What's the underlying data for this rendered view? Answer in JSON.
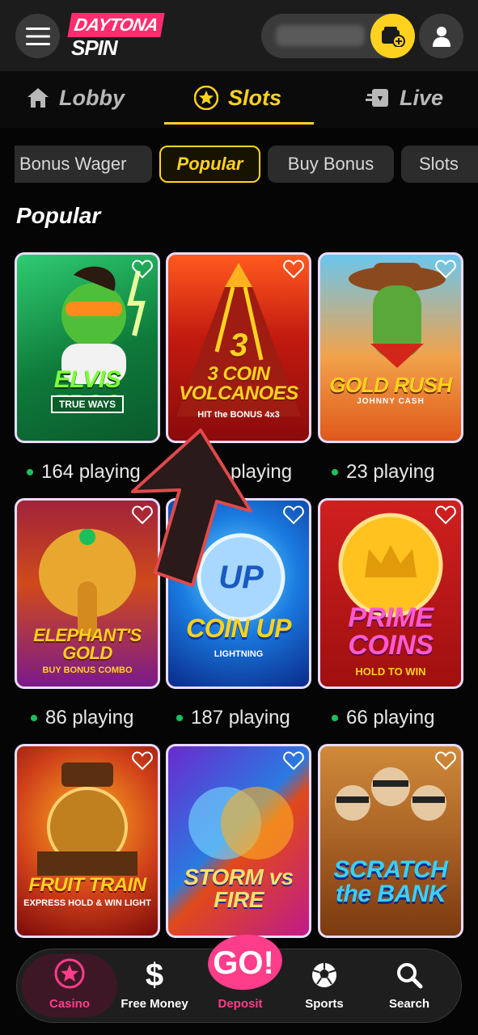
{
  "header": {
    "logo_top": "DAYTONA",
    "logo_bottom": "SPIN",
    "icons": {
      "menu": "menu-icon",
      "wallet": "wallet-add-icon",
      "profile": "user-icon"
    }
  },
  "main_tabs": [
    {
      "label": "Lobby",
      "icon": "home-icon",
      "active": false
    },
    {
      "label": "Slots",
      "icon": "star-icon",
      "active": true
    },
    {
      "label": "Live",
      "icon": "live-cards-icon",
      "active": false
    }
  ],
  "chips": [
    {
      "label": "Bonus Wager",
      "active": false
    },
    {
      "label": "Popular",
      "active": true
    },
    {
      "label": "Buy Bonus",
      "active": false
    },
    {
      "label": "Slots",
      "active": false
    }
  ],
  "section_title": "Popular",
  "games": [
    {
      "title": "ELVIS FROG",
      "sub": "TRUE WAYS",
      "playing": "164 playing"
    },
    {
      "title": "3 COIN VOLCANOES",
      "sub": "HIT the BONUS 4x3",
      "playing": "playing"
    },
    {
      "title": "GOLD RUSH",
      "sub": "JOHNNY CASH",
      "playing": "23 playing"
    },
    {
      "title": "ELEPHANT'S GOLD",
      "sub": "BUY BONUS COMBO",
      "playing": "86 playing"
    },
    {
      "title": "COIN UP",
      "sub": "LIGHTNING",
      "playing": "187 playing"
    },
    {
      "title": "PRIME COINS",
      "sub": "HOLD TO WIN",
      "playing": "66 playing"
    },
    {
      "title": "FRUIT TRAIN",
      "sub": "EXPRESS HOLD & WIN LIGHT",
      "playing": ""
    },
    {
      "title": "STORM vs FIRE",
      "sub": "",
      "playing": ""
    },
    {
      "title": "SCRATCH the BANK",
      "sub": "",
      "playing": ""
    }
  ],
  "bottom_nav": [
    {
      "label": "Casino",
      "icon": "star-circle-icon",
      "active": true
    },
    {
      "label": "Free Money",
      "icon": "dollar-icon",
      "active": false
    },
    {
      "label": "Deposit",
      "icon": "go-badge-icon",
      "active": false,
      "badge": "GO!"
    },
    {
      "label": "Sports",
      "icon": "soccer-ball-icon",
      "active": false
    },
    {
      "label": "Search",
      "icon": "search-icon",
      "active": false
    }
  ],
  "colors": {
    "accent": "#ffd21f",
    "brand_pink": "#ff2d6f",
    "live_dot": "#1bbf5c"
  }
}
